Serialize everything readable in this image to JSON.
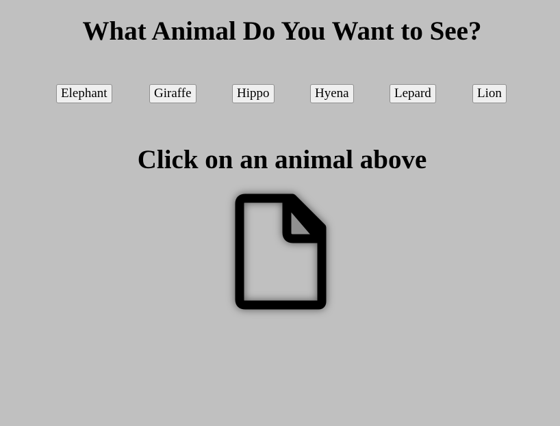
{
  "page": {
    "title": "What Animal Do You Want to See?",
    "subtitle": "Click on an animal above"
  },
  "animals": [
    {
      "label": "Elephant"
    },
    {
      "label": "Giraffe"
    },
    {
      "label": "Hippo"
    },
    {
      "label": "Hyena"
    },
    {
      "label": "Lepard"
    },
    {
      "label": "Lion"
    }
  ],
  "image": {
    "icon": "broken-image-icon"
  }
}
